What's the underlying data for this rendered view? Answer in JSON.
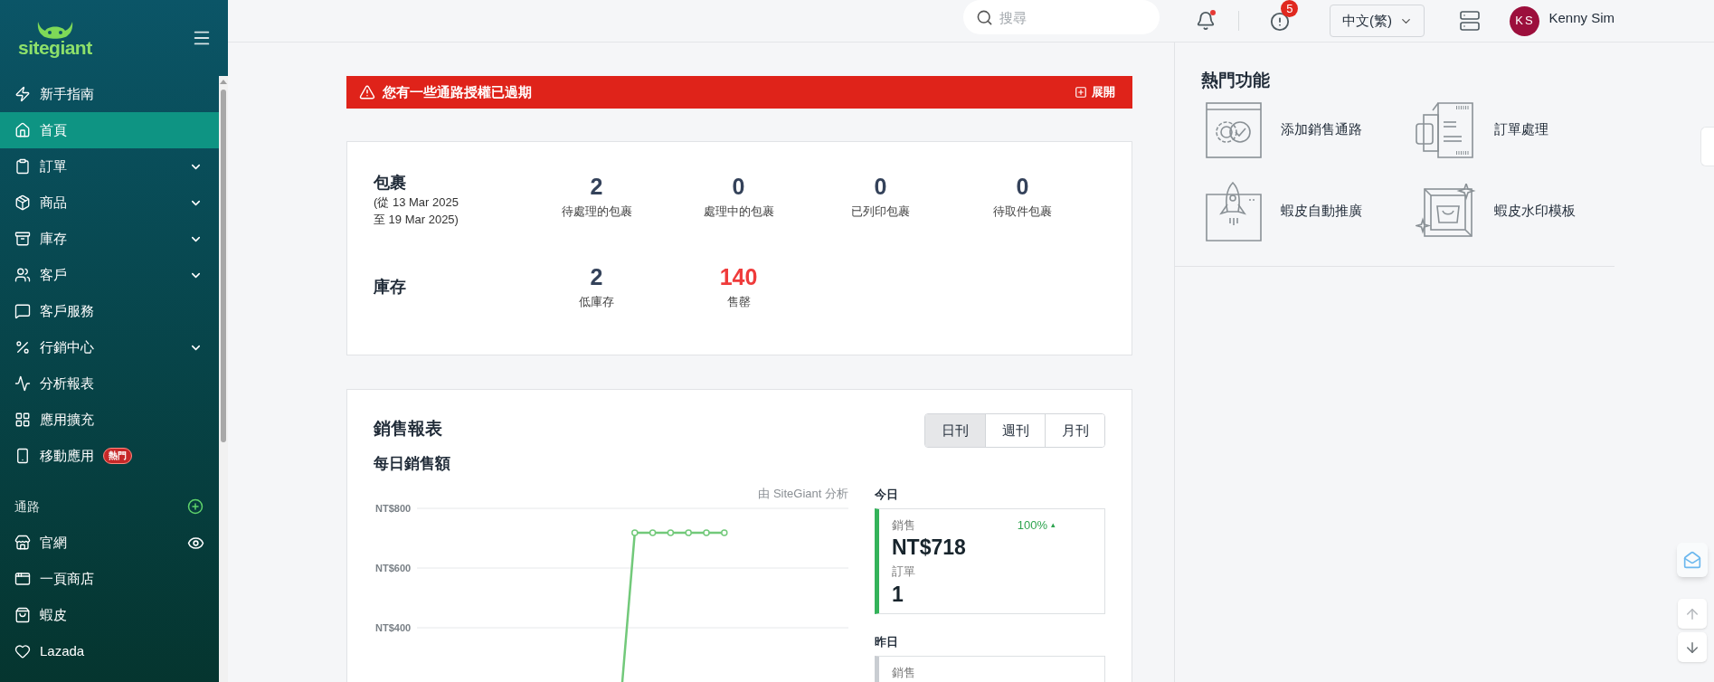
{
  "sidebar": {
    "logo_text": "sitegiant",
    "nav": [
      {
        "label": "新手指南",
        "selected": false,
        "expandable": false
      },
      {
        "label": "首頁",
        "selected": true,
        "expandable": false
      },
      {
        "label": "訂單",
        "selected": false,
        "expandable": true
      },
      {
        "label": "商品",
        "selected": false,
        "expandable": true
      },
      {
        "label": "庫存",
        "selected": false,
        "expandable": true
      },
      {
        "label": "客戶",
        "selected": false,
        "expandable": true
      },
      {
        "label": "客戶服務",
        "selected": false,
        "expandable": false
      },
      {
        "label": "行銷中心",
        "selected": false,
        "expandable": true
      },
      {
        "label": "分析報表",
        "selected": false,
        "expandable": false
      },
      {
        "label": "應用擴充",
        "selected": false,
        "expandable": false
      },
      {
        "label": "移動應用",
        "selected": false,
        "expandable": false,
        "badge": "熱門"
      }
    ],
    "channels_title": "通路",
    "channels": [
      {
        "label": "官網",
        "selected": false,
        "preview": true
      },
      {
        "label": "一頁商店",
        "selected": false,
        "preview": false
      },
      {
        "label": "蝦皮",
        "selected": false,
        "preview": false
      },
      {
        "label": "Lazada",
        "selected": false,
        "preview": false
      }
    ]
  },
  "topbar": {
    "search": {
      "placeholder": "搜尋"
    },
    "notifications": {
      "unread": true
    },
    "alerts": {
      "count": "5"
    },
    "language": "中文(繁)",
    "user": {
      "initials": "KS",
      "name": "Kenny Sim"
    }
  },
  "alert": {
    "text": "您有一些通路授權已過期",
    "action": "展開"
  },
  "stats": [
    {
      "title": "包裹",
      "subtitle": [
        "(從 13 Mar 2025",
        "至 19 Mar 2025)"
      ],
      "items": [
        {
          "value": "2",
          "label": "待處理的包裹",
          "warning": false
        },
        {
          "value": "0",
          "label": "處理中的包裹",
          "warning": false
        },
        {
          "value": "0",
          "label": "已列印包裹",
          "warning": false
        },
        {
          "value": "0",
          "label": "待取件包裹",
          "warning": false
        }
      ]
    },
    {
      "title": "庫存",
      "items": [
        {
          "value": "2",
          "label": "低庫存",
          "warning": false
        },
        {
          "value": "140",
          "label": "售罄",
          "warning": true
        }
      ]
    }
  ],
  "sales": {
    "title": "銷售報表",
    "tabs": [
      {
        "label": "日刊",
        "selected": true
      },
      {
        "label": "週刊",
        "selected": false
      },
      {
        "label": "月刊",
        "selected": false
      }
    ],
    "subtitle": "每日銷售額",
    "credit": "由 SiteGiant 分析",
    "chart": {
      "y_labels": [
        "NT$800",
        "NT$600",
        "NT$400"
      ]
    },
    "summary": [
      {
        "label": "今日",
        "color": "#34b35a",
        "sales_label": "銷售",
        "sales": "NT$718",
        "change": "100%",
        "change_icon": "▴",
        "orders_label": "訂單",
        "orders": "1"
      },
      {
        "label": "昨日",
        "color": "#c9cdd2",
        "sales_label": "銷售"
      }
    ]
  },
  "features": {
    "title": "熱門功能",
    "items": [
      {
        "label": "添加銷售通路",
        "kind": "settings"
      },
      {
        "label": "訂單處理",
        "kind": "printer"
      },
      {
        "label": "蝦皮自動推廣",
        "kind": "rocket"
      },
      {
        "label": "蝦皮水印模板",
        "kind": "frame"
      }
    ]
  }
}
